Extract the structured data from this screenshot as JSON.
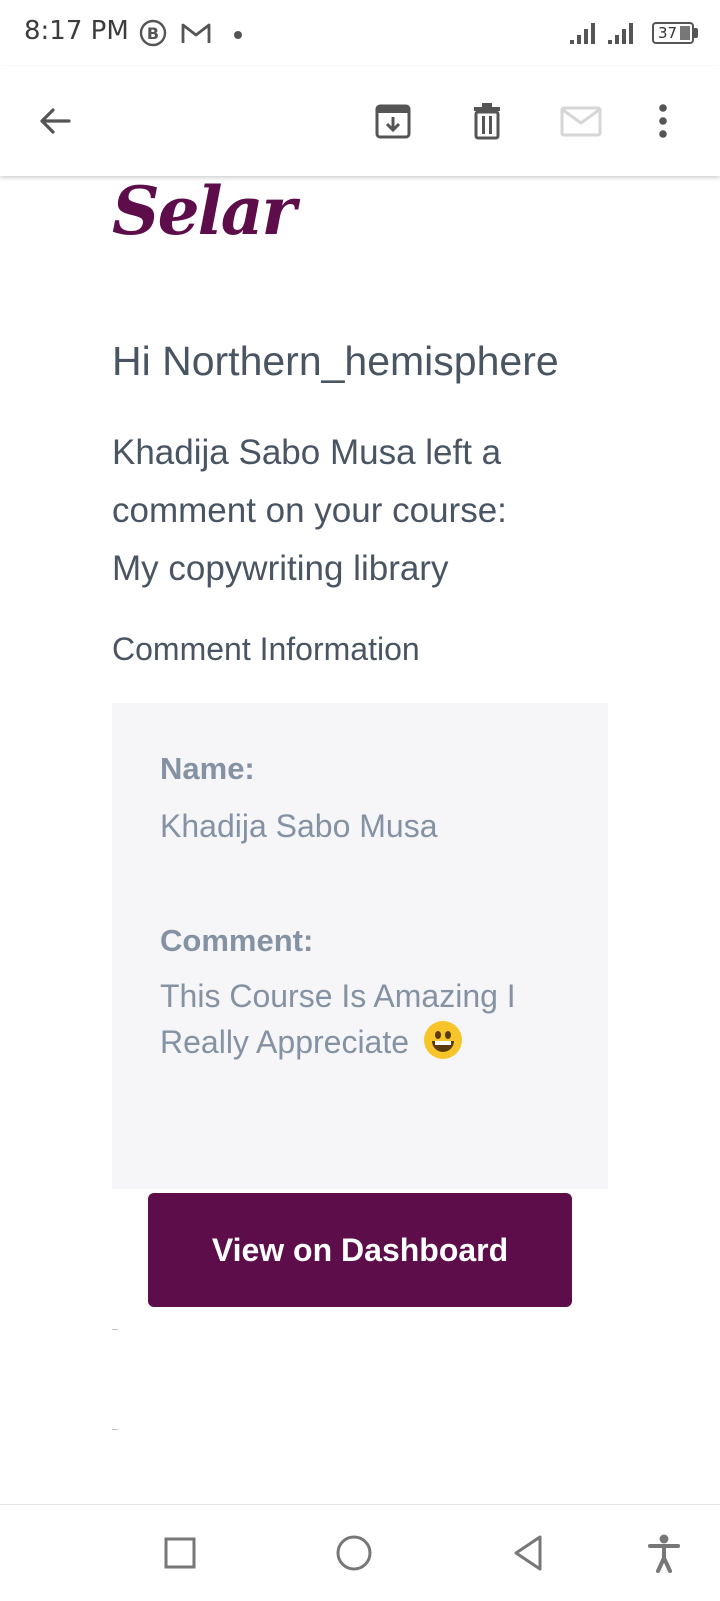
{
  "status_bar": {
    "time": "8:17 PM",
    "icons": [
      "b-circle-icon",
      "gmail-icon",
      "dot-icon"
    ],
    "battery_level": "37"
  },
  "app_bar": {
    "actions": [
      "back-arrow-icon",
      "archive-icon",
      "delete-icon",
      "mark-unread-icon",
      "more-vert-icon"
    ]
  },
  "email": {
    "logo_text": "Selar",
    "greeting": "Hi Northern_hemisphere",
    "intro_line1": "Khadija Sabo Musa left a",
    "intro_line2": "comment on your course:",
    "intro_line3": "My copywriting library",
    "section_title": "Comment Information",
    "name_label": "Name:",
    "name_value": "Khadija Sabo Musa",
    "comment_label": "Comment:",
    "comment_value_line1": "This Course Is Amazing I",
    "comment_value_line2": "Really Appreciate",
    "comment_emoji": "grinning-face-emoji",
    "cta_label": "View on Dashboard",
    "brand_color": "#5c0d4a"
  },
  "nav_bar": {
    "buttons": [
      "recents-square-icon",
      "home-circle-icon",
      "back-triangle-icon",
      "accessibility-icon"
    ]
  }
}
